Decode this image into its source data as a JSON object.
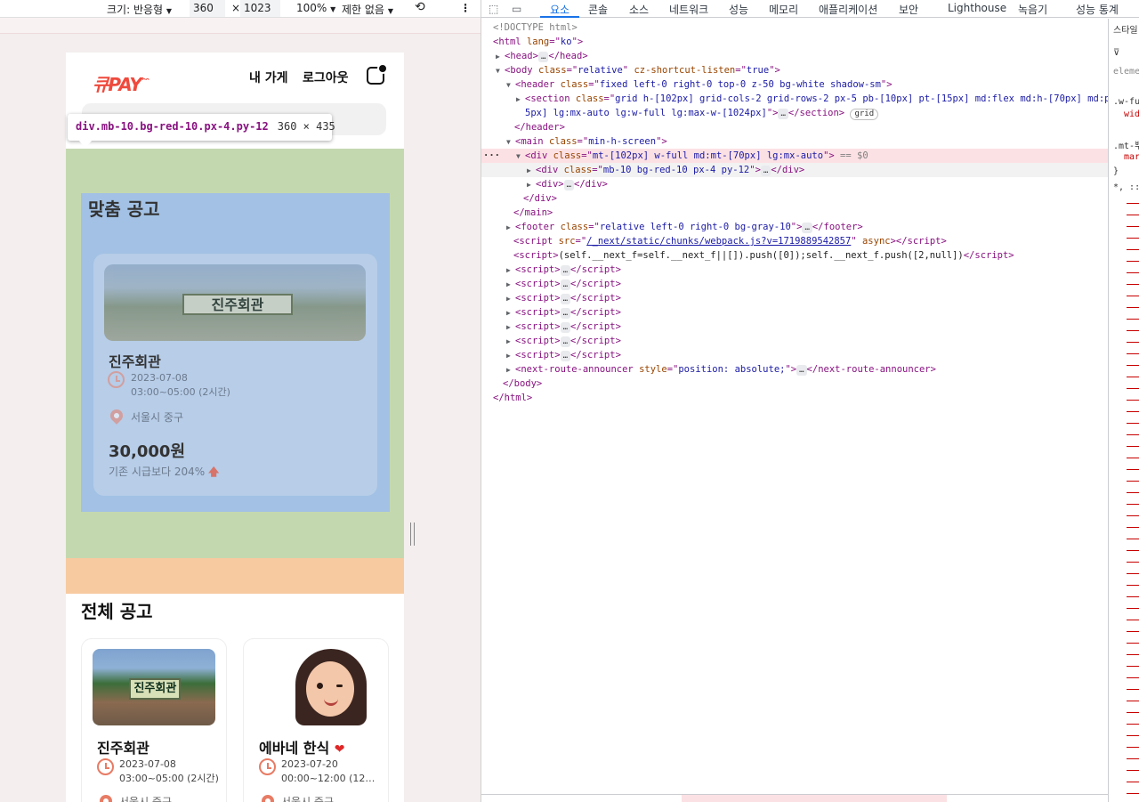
{
  "device_toolbar": {
    "size_label": "크기: 반응형",
    "width": "360",
    "times": "×",
    "height": "1023",
    "zoom": "100%",
    "throttle": "제한 없음"
  },
  "app": {
    "logo": "큐PAY",
    "nav": {
      "my_store": "내 가게",
      "logout": "로그아웃"
    },
    "featured": {
      "section_title": "맞춤 공고",
      "name": "진주회관",
      "date": "2023-07-08",
      "time": "03:00~05:00 (2시간)",
      "location": "서울시 중구",
      "price": "30,000원",
      "rate_note": "기존 시급보다 204%",
      "image_sign": "진주회관"
    },
    "all_section_title": "전체 공고",
    "list": [
      {
        "name": "진주회관",
        "date": "2023-07-08",
        "time": "03:00~05:00 (2시간)",
        "location": "서울시 중구",
        "image_sign": "진주회관"
      },
      {
        "name": "에바네 한식",
        "date": "2023-07-20",
        "time": "00:00~12:00 (12…",
        "location": "서울시 중구"
      }
    ]
  },
  "tooltip": {
    "selector": "div.mb-10.bg-red-10.px-4.py-12",
    "size": "360 × 435"
  },
  "devtools": {
    "tabs": [
      "요소",
      "콘솔",
      "소스",
      "네트워크",
      "성능",
      "메모리",
      "애플리케이션",
      "보안",
      "Lighthouse",
      "녹음기",
      "성능 통계"
    ],
    "active_tab": "요소",
    "styles_tab": "스타일",
    "styles_lines": [
      ".w-ful",
      "wid",
      ".mt-뿌",
      "mar",
      "}",
      "*, ::b"
    ],
    "element_label": "elemen",
    "dom": {
      "doctype": "<!DOCTYPE html>",
      "html_tag": "html",
      "html_lang_attr": "lang",
      "html_lang": "ko",
      "head": "head",
      "body_tag": "body",
      "body_class": "relative",
      "body_attr2": "cz-shortcut-listen",
      "body_attr2_val": "true",
      "header_class": "fixed left-0 right-0 top-0 z-50 bg-white shadow-sm",
      "section_class": "grid h-[102px] grid-cols-2 grid-rows-2 px-5 pb-[10px] pt-[15px] md:flex md:h-[70px] md:px-8 md:py-[1",
      "section_class2": "5px] lg:mx-auto lg:w-full lg:max-w-[1024px]",
      "grid_badge": "grid",
      "main_class": "min-h-screen",
      "div_class": "mt-[102px] w-full md:mt-[70px] lg:mx-auto",
      "eq_sign": "== $0",
      "inner_div_class": "mb-10 bg-red-10 px-4 py-12",
      "footer_class": "relative left-0 right-0 bg-gray-10",
      "script_src": "/_next/static/chunks/webpack.js?v=1719889542857",
      "script_async": "async",
      "inline_script": "(self.__next_f=self.__next_f||[]).push([0]);self.__next_f.push([2,null])",
      "announcer": "next-route-announcer",
      "announcer_style": "position: absolute;",
      "ellipsis": "…"
    }
  }
}
